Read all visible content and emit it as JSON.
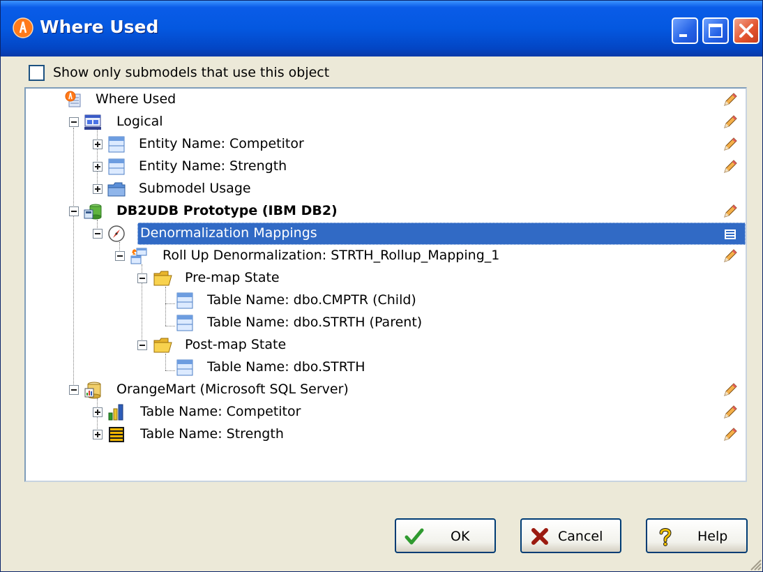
{
  "window": {
    "title": "Where Used"
  },
  "options": {
    "show_only_submodels_label": "Show only submodels that use this object",
    "show_only_submodels_checked": false
  },
  "tree": {
    "root": "Where Used",
    "logical": "Logical",
    "entity_competitor": "Entity Name: Competitor",
    "entity_strength": "Entity Name: Strength",
    "submodel_usage": "Submodel Usage",
    "db2_model": "DB2UDB Prototype (IBM DB2)",
    "denorm_mappings": "Denormalization Mappings",
    "rollup": "Roll Up Denormalization: STRTH_Rollup_Mapping_1",
    "premap": "Pre-map State",
    "table_cmptr": "Table Name: dbo.CMPTR (Child)",
    "table_strth_parent": "Table Name: dbo.STRTH (Parent)",
    "postmap": "Post-map State",
    "table_strth": "Table Name: dbo.STRTH",
    "orangemart": "OrangeMart (Microsoft SQL Server)",
    "table_competitor": "Table Name: Competitor",
    "table_strength": "Table Name: Strength"
  },
  "buttons": {
    "ok": "OK",
    "cancel": "Cancel",
    "help": "Help"
  },
  "colors": {
    "titlebar": "#0458e0",
    "selection": "#316ac5",
    "dialog_bg": "#ece9d8"
  },
  "icons": {
    "edit": "pencil-icon",
    "properties": "properties-icon",
    "ok": "checkmark-icon",
    "cancel": "x-icon",
    "help": "question-icon"
  }
}
